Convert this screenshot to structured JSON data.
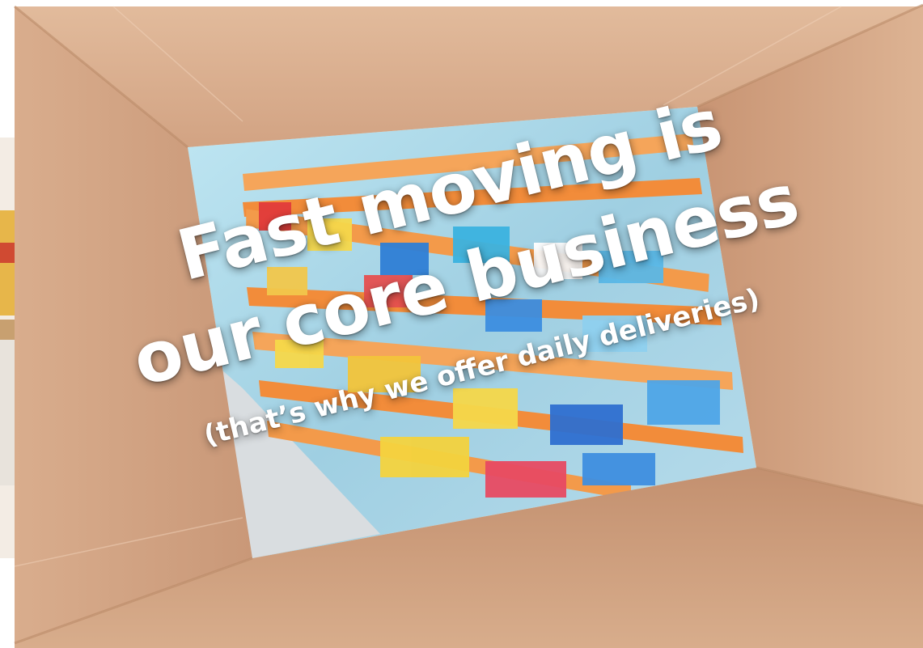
{
  "headline": {
    "line1": "Fast moving is",
    "line2": "our core business",
    "line3": "(that’s why we offer daily deliveries)"
  },
  "colors": {
    "cardboard": "#d3a585",
    "cardboard_dark": "#bf8d6b",
    "shelf_orange": "#f28c3a",
    "text": "#ffffff"
  }
}
